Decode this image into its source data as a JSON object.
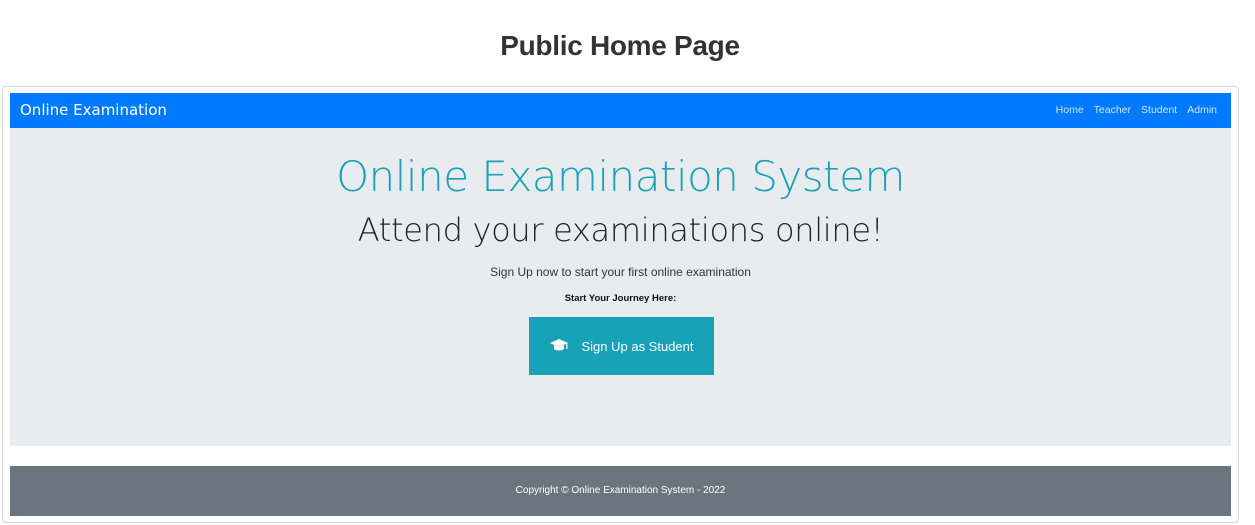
{
  "page": {
    "heading": "Public Home Page"
  },
  "navbar": {
    "brand": "Online Examination",
    "links": [
      "Home",
      "Teacher",
      "Student",
      "Admin"
    ],
    "background_color": "#007bff"
  },
  "hero": {
    "title": "Online Examination System",
    "subtitle": "Attend your examinations online!",
    "lead": "Sign Up now to start your first online examination",
    "cta_label": "Start Your Journey Here:",
    "signup_button": {
      "label": "Sign Up as Student",
      "icon": "graduation-cap-icon",
      "color": "#17a2b8"
    },
    "background_color": "#e9ecef"
  },
  "footer": {
    "text": "Copyright © Online Examination System - 2022",
    "background_color": "#6c757d"
  }
}
